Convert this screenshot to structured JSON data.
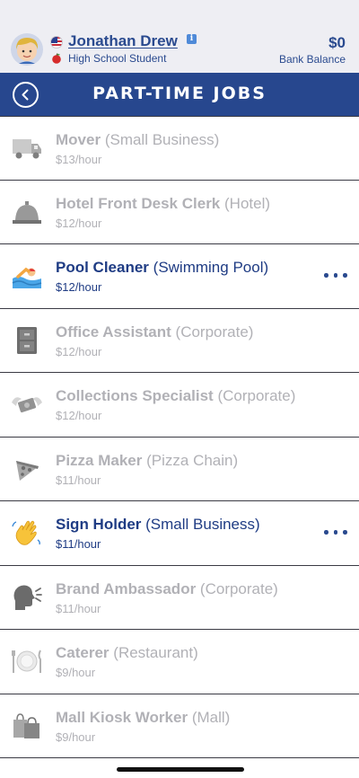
{
  "header": {
    "player_name": "Jonathan Drew",
    "info_badge": "i",
    "player_status": "High School Student",
    "balance": "$0",
    "balance_label": "Bank Balance",
    "icons": [
      "avatar",
      "us-flag-icon",
      "info-icon",
      "apple-icon"
    ]
  },
  "titlebar": {
    "title": "PART-TIME JOBS",
    "back_icon": "chevron-left-icon"
  },
  "colors": {
    "header_bg": "#eeeef3",
    "titlebar_bg": "#27478e",
    "active_text": "#1f3c84",
    "locked_text": "#b1b1b6"
  },
  "jobs": [
    {
      "name": "Mover",
      "place": "(Small Business)",
      "wage": "$13/hour",
      "icon": "truck-icon",
      "available": false
    },
    {
      "name": "Hotel Front Desk Clerk",
      "place": "(Hotel)",
      "wage": "$12/hour",
      "icon": "service-bell-icon",
      "available": false
    },
    {
      "name": "Pool Cleaner",
      "place": "(Swimming Pool)",
      "wage": "$12/hour",
      "icon": "swimmer-icon",
      "available": true
    },
    {
      "name": "Office Assistant",
      "place": "(Corporate)",
      "wage": "$12/hour",
      "icon": "file-cabinet-icon",
      "available": false
    },
    {
      "name": "Collections Specialist",
      "place": "(Corporate)",
      "wage": "$12/hour",
      "icon": "money-wings-icon",
      "available": false
    },
    {
      "name": "Pizza Maker",
      "place": "(Pizza Chain)",
      "wage": "$11/hour",
      "icon": "pizza-icon",
      "available": false
    },
    {
      "name": "Sign Holder",
      "place": "(Small Business)",
      "wage": "$11/hour",
      "icon": "waving-hand-icon",
      "available": true
    },
    {
      "name": "Brand Ambassador",
      "place": "(Corporate)",
      "wage": "$11/hour",
      "icon": "speaking-head-icon",
      "available": false
    },
    {
      "name": "Caterer",
      "place": "(Restaurant)",
      "wage": "$9/hour",
      "icon": "plate-cutlery-icon",
      "available": false
    },
    {
      "name": "Mall Kiosk Worker",
      "place": "(Mall)",
      "wage": "$9/hour",
      "icon": "shopping-bags-icon",
      "available": false
    }
  ]
}
